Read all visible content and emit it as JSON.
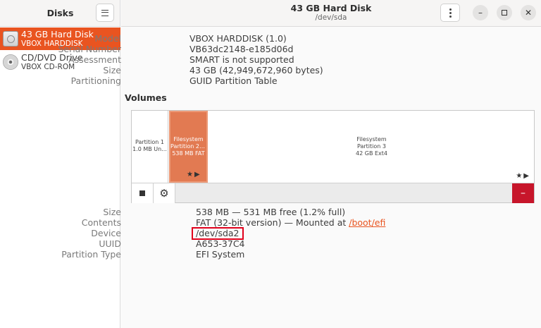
{
  "sidebar": {
    "title": "Disks",
    "drives": [
      {
        "name": "43 GB Hard Disk",
        "sub": "VBOX HARDDISK",
        "icon": "hard-disk-icon",
        "selected": true
      },
      {
        "name": "CD/DVD Drive",
        "sub": "VBOX CD-ROM",
        "icon": "optical-drive-icon",
        "selected": false
      }
    ]
  },
  "header": {
    "title": "43 GB Hard Disk",
    "subtitle": "/dev/sda"
  },
  "disk": {
    "model_label": "Model",
    "model": "VBOX HARDDISK (1.0)",
    "serial_label": "Serial Number",
    "serial": "VB63dc2148-e185d06d",
    "assessment_label": "Assessment",
    "assessment": "SMART is not supported",
    "size_label": "Size",
    "size": "43 GB (42,949,672,960 bytes)",
    "partitioning_label": "Partitioning",
    "partitioning": "GUID Partition Table"
  },
  "volumes": {
    "title": "Volumes",
    "partitions": [
      {
        "line1": "Partition 1",
        "line2": "1.0 MB Un..."
      },
      {
        "line1": "Filesystem",
        "line2": "Partition 2: ...",
        "line3": "538 MB FAT",
        "selected": true
      },
      {
        "line1": "Filesystem",
        "line2": "Partition 3",
        "line3": "42 GB Ext4"
      }
    ],
    "icons": {
      "star": "★",
      "play": "▶"
    },
    "toolbar": {
      "stop": "stop-icon",
      "settings": "gear-icon",
      "delete_glyph": "–"
    }
  },
  "volume_info": {
    "size_label": "Size",
    "size": "538 MB — 531 MB free (1.2% full)",
    "contents_label": "Contents",
    "contents": "FAT (32-bit version) — Mounted at ",
    "mount_link": "/boot/efi",
    "device_label": "Device",
    "device": "/dev/sda2",
    "uuid_label": "UUID",
    "uuid": "A653-37C4",
    "ptype_label": "Partition Type",
    "ptype": "EFI System"
  },
  "colors": {
    "accent": "#e95420",
    "danger": "#c7162b",
    "highlight": "#e0001b"
  }
}
